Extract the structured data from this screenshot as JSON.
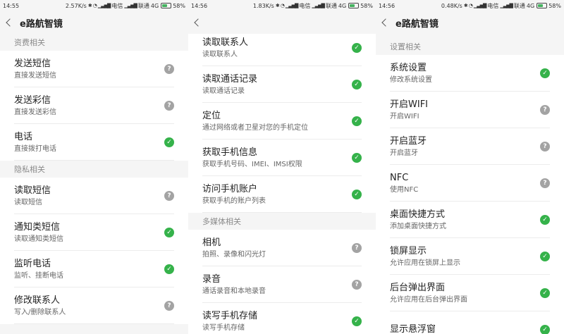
{
  "colors": {
    "allowed": "#35b24a",
    "ask": "#a3a3a3",
    "background": "#f5f5f5"
  },
  "screens": [
    {
      "status": {
        "time": "14:55",
        "speed": "2.57K/s",
        "carrier1": "电信",
        "carrier2": "联通",
        "net": "4G",
        "battery": "58%"
      },
      "title": "e路航智镜",
      "sections": [
        {
          "header": "资费相关",
          "items": [
            {
              "title": "发送短信",
              "subtitle": "直接发送短信",
              "status": "ask"
            },
            {
              "title": "发送彩信",
              "subtitle": "直接发送彩信",
              "status": "ask"
            },
            {
              "title": "电话",
              "subtitle": "直接拨打电话",
              "status": "allowed"
            }
          ]
        },
        {
          "header": "隐私相关",
          "items": [
            {
              "title": "读取短信",
              "subtitle": "读取短信",
              "status": "ask"
            },
            {
              "title": "通知类短信",
              "subtitle": "读取通知类短信",
              "status": "allowed"
            },
            {
              "title": "监听电话",
              "subtitle": "监听、挂断电话",
              "status": "allowed"
            },
            {
              "title": "修改联系人",
              "subtitle": "写入/删除联系人",
              "status": "ask"
            }
          ]
        }
      ]
    },
    {
      "status": {
        "time": "14:56",
        "speed": "1.83K/s",
        "carrier1": "电信",
        "carrier2": "联通",
        "net": "4G",
        "battery": "58%"
      },
      "title": "",
      "sections": [
        {
          "header": "",
          "items": [
            {
              "title": "读取联系人",
              "subtitle": "读取联系人",
              "status": "allowed"
            },
            {
              "title": "读取通话记录",
              "subtitle": "读取通话记录",
              "status": "allowed"
            },
            {
              "title": "定位",
              "subtitle": "通过网络或者卫星对您的手机定位",
              "status": "allowed"
            },
            {
              "title": "获取手机信息",
              "subtitle": "获取手机号码、IMEI、IMSI权限",
              "status": "allowed"
            },
            {
              "title": "访问手机账户",
              "subtitle": "获取手机的账户列表",
              "status": "allowed"
            }
          ]
        },
        {
          "header": "多媒体相关",
          "items": [
            {
              "title": "相机",
              "subtitle": "拍照、录像和闪光灯",
              "status": "ask"
            },
            {
              "title": "录音",
              "subtitle": "通话录音和本地录音",
              "status": "ask"
            },
            {
              "title": "读写手机存储",
              "subtitle": "读写手机存储",
              "status": "allowed"
            }
          ]
        }
      ]
    },
    {
      "status": {
        "time": "14:56",
        "speed": "0.48K/s",
        "carrier1": "电信",
        "carrier2": "联通",
        "net": "4G",
        "battery": "58%"
      },
      "title": "e路航智镜",
      "sections": [
        {
          "header": "设置相关",
          "items": [
            {
              "title": "系统设置",
              "subtitle": "修改系统设置",
              "status": "allowed"
            },
            {
              "title": "开启WIFI",
              "subtitle": "开启WIFI",
              "status": "ask"
            },
            {
              "title": "开启蓝牙",
              "subtitle": "开启蓝牙",
              "status": "ask"
            },
            {
              "title": "NFC",
              "subtitle": "使用NFC",
              "status": "ask"
            },
            {
              "title": "桌面快捷方式",
              "subtitle": "添加桌面快捷方式",
              "status": "allowed"
            },
            {
              "title": "锁屏显示",
              "subtitle": "允许应用在锁屏上显示",
              "status": "allowed"
            },
            {
              "title": "后台弹出界面",
              "subtitle": "允许应用在后台弹出界面",
              "status": "allowed"
            },
            {
              "title": "显示悬浮窗",
              "subtitle": "",
              "status": "allowed"
            }
          ]
        }
      ]
    }
  ],
  "icons": {
    "allowed": "check-icon",
    "ask": "question-icon",
    "back": "back-arrow-icon"
  },
  "glyphs": {
    "allowed": "✓",
    "ask": "?"
  }
}
